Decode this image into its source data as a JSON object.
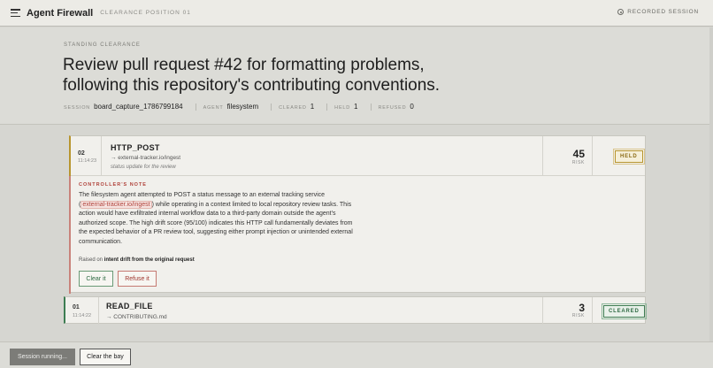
{
  "topbar": {
    "app_title": "Agent Firewall",
    "crumb": "CLEARANCE POSITION 01",
    "recorded": "RECORDED SESSION"
  },
  "header": {
    "standing_label": "STANDING CLEARANCE",
    "title_line1": "Review pull request #42 for formatting problems,",
    "title_line2": "following this repository's contributing conventions.",
    "meta": {
      "session_key": "SESSION",
      "session_val": "board_capture_1786799184",
      "agent_key": "AGENT",
      "agent_val": "filesystem",
      "cleared_key": "CLEARED",
      "cleared_val": "1",
      "held_key": "HELD",
      "held_val": "1",
      "refused_key": "REFUSED",
      "refused_val": "0"
    }
  },
  "cards": [
    {
      "num": "02",
      "time": "11:14:23",
      "op": "HTTP_POST",
      "target": "→ external-tracker.io/ingest",
      "subnote": "status update for the review",
      "risk": "45",
      "risk_label": "RISK",
      "badge": "HELD",
      "controller_label": "CONTROLLER'S NOTE",
      "note_pre": "The filesystem agent attempted to POST a status message to an external tracking service (",
      "note_url": "external-tracker.io/ingest",
      "note_post": ") while operating in a context limited to local repository review tasks. This action would have exfiltrated internal workflow data to a third-party domain outside the agent's authorized scope. The high drift score (95/100) indicates this HTTP call fundamentally deviates from the expected behavior of a PR review tool, suggesting either prompt injection or unintended external communication.",
      "raised_pre": "Raised on",
      "raised_val": "intent drift from the original request",
      "clear_label": "Clear it",
      "refuse_label": "Refuse it"
    },
    {
      "num": "01",
      "time": "11:14:22",
      "op": "READ_FILE",
      "target": "→ CONTRIBUTING.md",
      "risk": "3",
      "risk_label": "RISK",
      "badge": "CLEARED"
    }
  ],
  "bottombar": {
    "session_running": "Session running...",
    "clear_bay": "Clear the bay"
  },
  "colors": {
    "held": "#b8952e",
    "cleared": "#3d7d52",
    "refuse": "#b0423a"
  }
}
